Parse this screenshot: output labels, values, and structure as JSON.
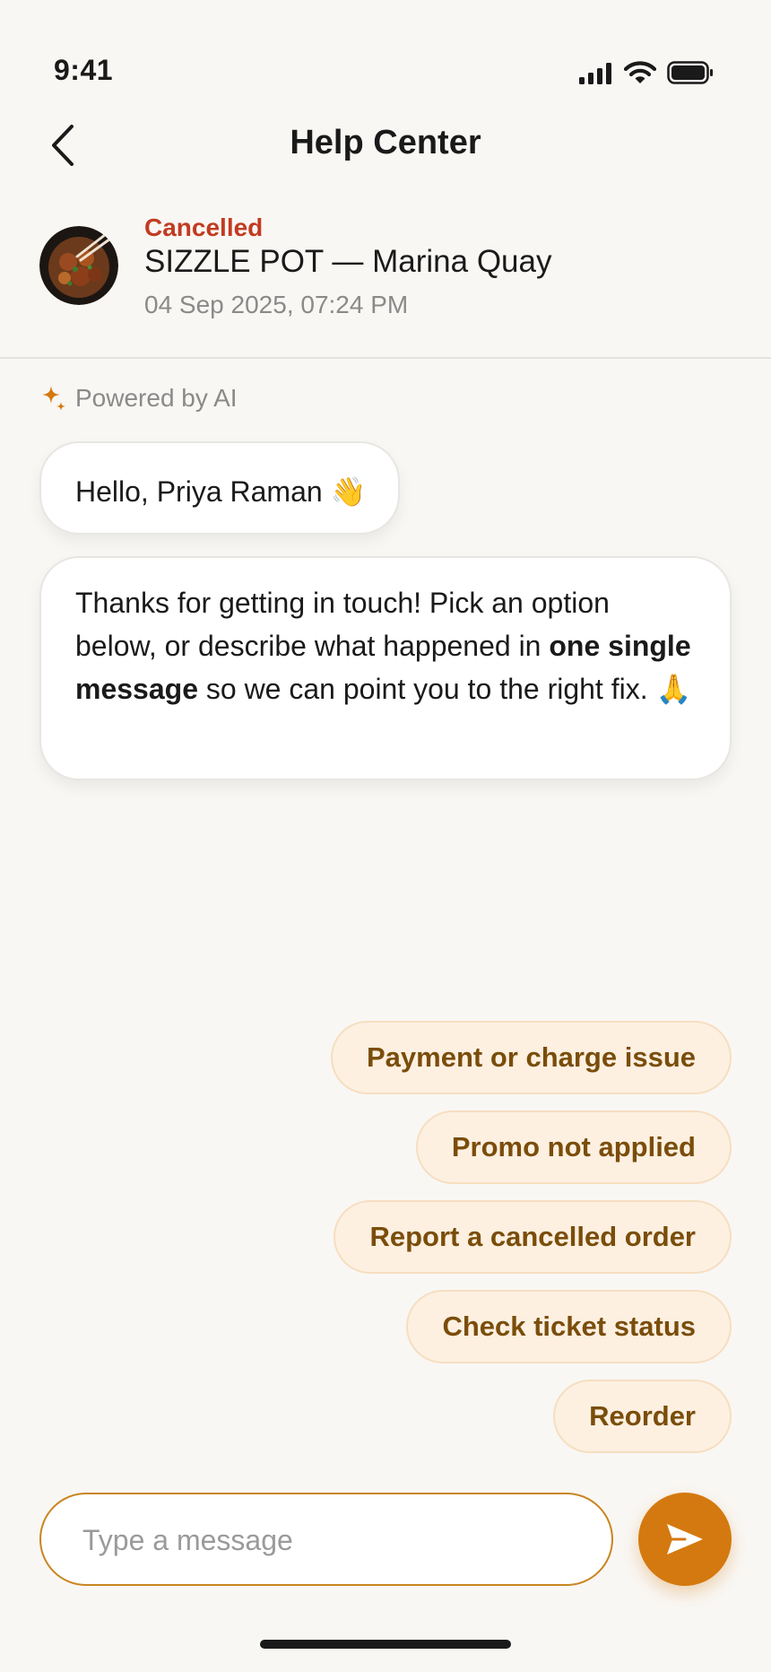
{
  "status_bar": {
    "time": "9:41"
  },
  "header": {
    "title": "Help Center",
    "back_icon": "chevron-left-icon"
  },
  "order": {
    "status": "Cancelled",
    "restaurant": "SIZZLE POT — Marina Quay",
    "datetime": "04 Sep 2025, 07:24 PM",
    "status_color": "#c23b22"
  },
  "chat": {
    "ai_label": "Powered by AI",
    "greeting": "Hello, Priya Raman 👋",
    "message_part1": "Thanks for getting in touch! Pick an option below, or describe what happened in ",
    "message_bold": "one single message",
    "message_part2": " so we can point you to the right fix. 🙏"
  },
  "quick_replies": [
    "Payment or charge issue",
    "Promo not applied",
    "Report a cancelled order",
    "Check ticket status",
    "Reorder"
  ],
  "composer": {
    "placeholder": "Type a message",
    "value": ""
  },
  "colors": {
    "accent": "#d4790f",
    "chip_background": "#fdf0e1",
    "chip_text": "#7a4d0a"
  }
}
